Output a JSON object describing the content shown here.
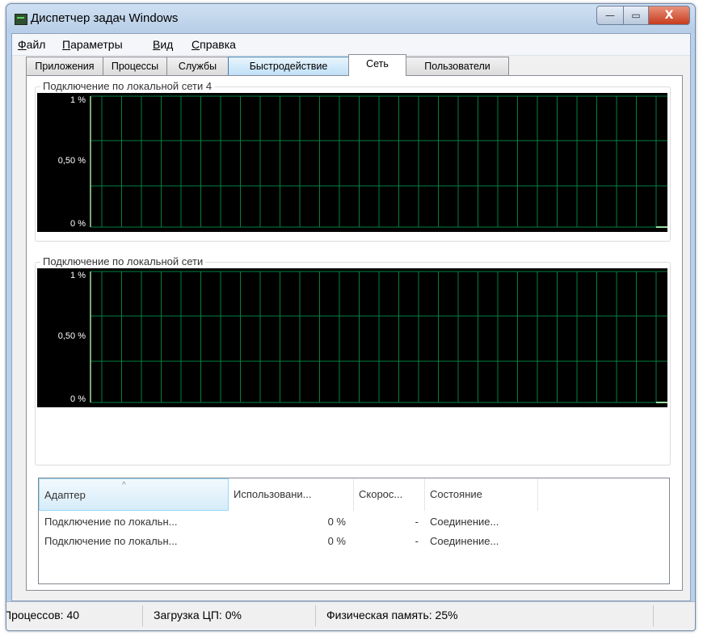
{
  "window": {
    "title": "Диспетчер задач Windows",
    "close_glyph": "X",
    "min_glyph": "—",
    "max_glyph": "▭"
  },
  "menu": [
    {
      "u": "Ф",
      "rest": "айл"
    },
    {
      "u": "П",
      "rest": "араметры"
    },
    {
      "u": "В",
      "rest": "ид"
    },
    {
      "u": "С",
      "rest": "правка"
    }
  ],
  "tabs": [
    "Приложения",
    "Процессы",
    "Службы",
    "Быстродействие",
    "Сеть",
    "Пользователи"
  ],
  "active_tab": "Сеть",
  "graphs": [
    {
      "title": "Подключение по локальной сети 4",
      "y_labels": [
        "1 %",
        "0,50 %",
        "0 %"
      ],
      "utilization_percent": 0
    },
    {
      "title": "Подключение по локальной сети",
      "y_labels": [
        "1 %",
        "0,50 %",
        "0 %"
      ],
      "utilization_percent": 0
    }
  ],
  "colors": {
    "graph_bg": "#000000",
    "grid": "#008040",
    "line": "#9fe09f"
  },
  "adapters_table": {
    "sort_indicator": "^",
    "columns": [
      "Адаптер",
      "Использовани...",
      "Скорос...",
      "Состояние"
    ],
    "rows": [
      [
        "Подключение по локальн...",
        "0 %",
        "-",
        "Соединение..."
      ],
      [
        "Подключение по локальн...",
        "0 %",
        "-",
        "Соединение..."
      ]
    ]
  },
  "status": {
    "processes": "Процессов: 40",
    "cpu": "Загрузка ЦП: 0%",
    "memory": "Физическая память: 25%"
  }
}
